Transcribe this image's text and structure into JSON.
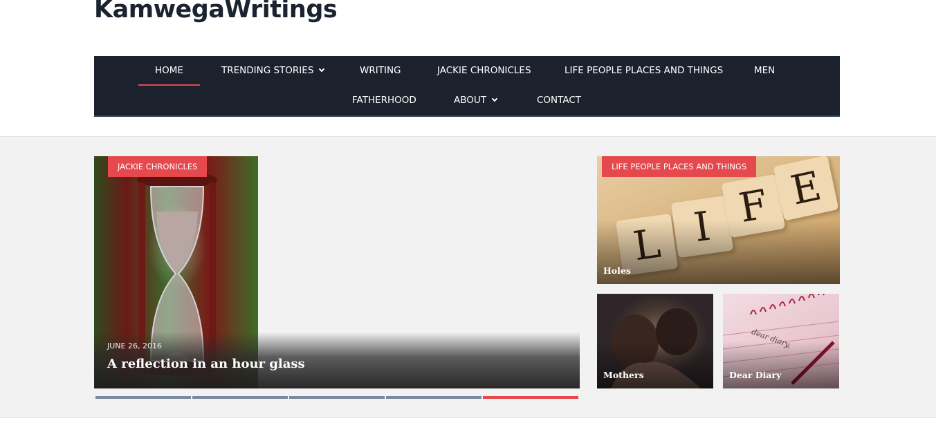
{
  "site": {
    "title": "KamwegaWritings"
  },
  "nav": {
    "items": [
      {
        "label": "HOME",
        "active": true,
        "dropdown": false
      },
      {
        "label": "TRENDING STORIES",
        "active": false,
        "dropdown": true
      },
      {
        "label": "WRITING",
        "active": false,
        "dropdown": false
      },
      {
        "label": "JACKIE CHRONICLES",
        "active": false,
        "dropdown": false
      },
      {
        "label": "LIFE PEOPLE PLACES AND THINGS",
        "active": false,
        "dropdown": false
      },
      {
        "label": "MEN",
        "active": false,
        "dropdown": false
      },
      {
        "label": "FATHERHOOD",
        "active": false,
        "dropdown": false
      },
      {
        "label": "ABOUT",
        "active": false,
        "dropdown": true
      },
      {
        "label": "CONTACT",
        "active": false,
        "dropdown": false
      }
    ]
  },
  "slider": {
    "category": "JACKIE CHRONICLES",
    "date": "JUNE 26, 2016",
    "title": "A reflection in an hour glass",
    "slide_count": 5,
    "active_slide": 5
  },
  "featured": {
    "life": {
      "category": "LIFE PEOPLE PLACES AND THINGS",
      "title": "Holes",
      "letters": [
        "L",
        "I",
        "F",
        "E"
      ]
    },
    "mothers": {
      "title": "Mothers"
    },
    "diary": {
      "title": "Dear Diary",
      "handwriting": "dear diary,"
    }
  },
  "colors": {
    "accent": "#e5484d",
    "nav_bg": "#1b222d",
    "hero_bg": "#f2f2f2",
    "dot_inactive": "#7b8aa0"
  }
}
